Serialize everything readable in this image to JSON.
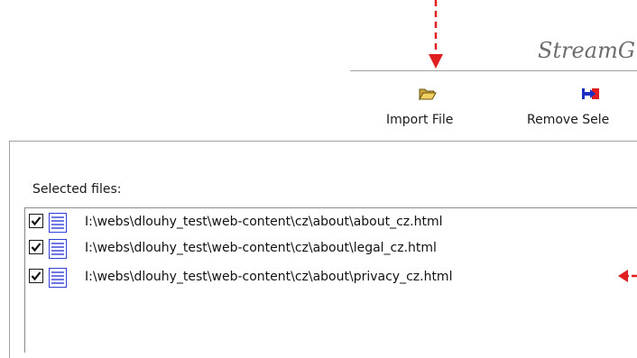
{
  "window": {
    "title": "StreamG"
  },
  "toolbar": {
    "import_label": "Import File",
    "remove_label": "Remove Sele",
    "import_icon": "open-folder-icon",
    "remove_icon": "remove-arrow-icon"
  },
  "files_panel": {
    "label": "Selected files:",
    "files": [
      {
        "checked": true,
        "path": "I:\\webs\\dlouhy_test\\web-content\\cz\\about\\about_cz.html"
      },
      {
        "checked": true,
        "path": "I:\\webs\\dlouhy_test\\web-content\\cz\\about\\legal_cz.html"
      },
      {
        "checked": true,
        "path": "I:\\webs\\dlouhy_test\\web-content\\cz\\about\\privacy_cz.html"
      }
    ]
  },
  "colors": {
    "annotation": "#e02020",
    "title": "#6d6d6d",
    "doc_icon": "#2f3fd8"
  }
}
